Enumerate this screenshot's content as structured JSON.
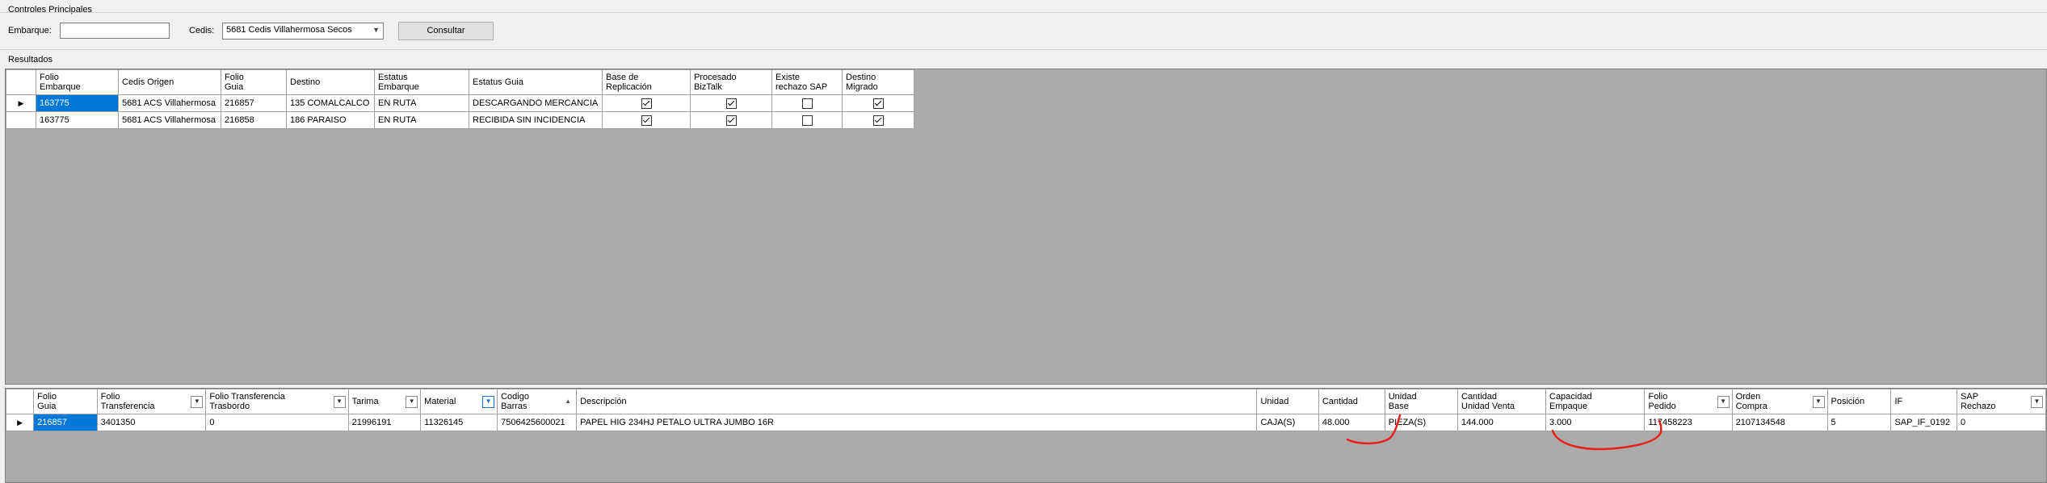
{
  "controls": {
    "title": "Controles Principales",
    "embarque_label": "Embarque:",
    "embarque_value": "",
    "cedis_label": "Cedis:",
    "cedis_value": "5681 Cedis Villahermosa Secos",
    "consultar_label": "Consultar"
  },
  "results_title": "Resultados",
  "grid1": {
    "columns": [
      {
        "label": "Folio\nEmbarque",
        "w": 93
      },
      {
        "label": "Cedis Origen",
        "w": 118
      },
      {
        "label": "Folio\nGuia",
        "w": 72
      },
      {
        "label": "Destino",
        "w": 100
      },
      {
        "label": "Estatus\nEmbarque",
        "w": 108
      },
      {
        "label": "Estatus Guia",
        "w": 156
      },
      {
        "label": "Base de\nReplicación",
        "w": 100
      },
      {
        "label": "Procesado\nBizTalk",
        "w": 92
      },
      {
        "label": "Existe\nrechazo SAP",
        "w": 78
      },
      {
        "label": "Destino\nMigrado",
        "w": 80
      }
    ],
    "rows": [
      {
        "cells": [
          "163775",
          "5681 ACS Villahermosa",
          "216857",
          "135 COMALCALCO",
          "EN RUTA",
          "DESCARGANDO MERCANCIA"
        ],
        "checks": [
          true,
          true,
          false,
          true
        ],
        "current": true
      },
      {
        "cells": [
          "163775",
          "5681 ACS Villahermosa",
          "216858",
          "186 PARAISO",
          "EN RUTA",
          "RECIBIDA SIN INCIDENCIA"
        ],
        "checks": [
          true,
          true,
          false,
          true
        ],
        "current": false
      }
    ]
  },
  "grid2": {
    "columns": [
      {
        "label": "Folio\nGuia",
        "w": 73,
        "filter": false
      },
      {
        "label": "Folio\nTransferencia",
        "w": 132,
        "filter": true
      },
      {
        "label": "Folio Transferencia\nTrasbordo",
        "w": 178,
        "filter": true
      },
      {
        "label": "Tarima",
        "w": 84,
        "filter": true
      },
      {
        "label": "Material",
        "w": 90,
        "filter": true,
        "filterActive": true
      },
      {
        "label": "Codigo\nBarras",
        "w": 90,
        "sort": true
      },
      {
        "label": "Descripción",
        "w": 897
      },
      {
        "label": "Unidad",
        "w": 70
      },
      {
        "label": "Cantidad",
        "w": 76
      },
      {
        "label": "Unidad\nBase",
        "w": 85
      },
      {
        "label": "Cantidad\nUnidad Venta",
        "w": 106
      },
      {
        "label": "Capacidad\nEmpaque",
        "w": 120
      },
      {
        "label": "Folio\nPedido",
        "w": 104,
        "filter": true
      },
      {
        "label": "Orden\nCompra",
        "w": 114,
        "filter": true
      },
      {
        "label": "Posición",
        "w": 73
      },
      {
        "label": "IF",
        "w": 73
      },
      {
        "label": "SAP\nRechazo",
        "w": 107,
        "filter": true
      }
    ],
    "rows": [
      {
        "cells": [
          "216857",
          "3401350",
          "0",
          "21996191",
          "11326145",
          "7506425600021",
          "PAPEL HIG 234HJ PETALO ULTRA JUMBO 16R",
          "CAJA(S)",
          "48.000",
          "PIEZA(S)",
          "144.000",
          "3.000",
          "117458223",
          "2107134548",
          "5",
          "SAP_IF_0192",
          "0"
        ],
        "current": true
      }
    ]
  },
  "colors": {
    "selection": "#0078d7",
    "annotation": "#e8201c",
    "grid_bg": "#ababab"
  }
}
